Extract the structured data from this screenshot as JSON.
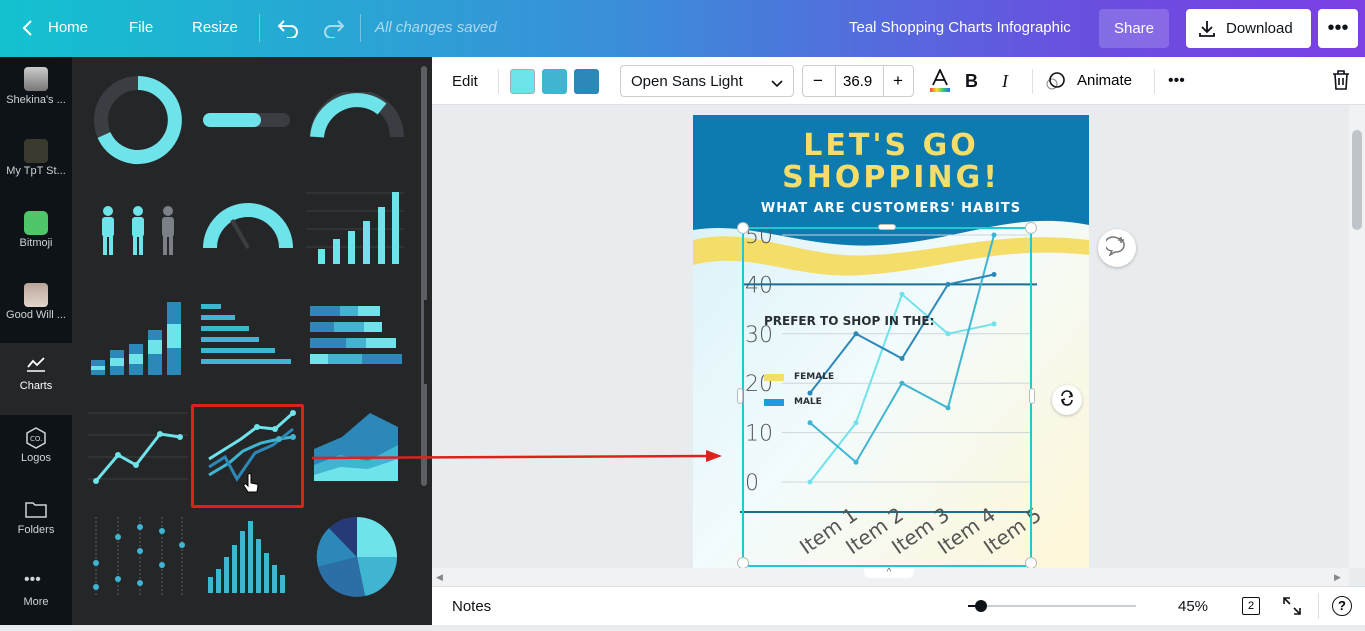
{
  "topbar": {
    "home": "Home",
    "file": "File",
    "resize": "Resize",
    "save_status": "All changes saved",
    "doc_title": "Teal Shopping Charts Infographic",
    "share": "Share",
    "download": "Download"
  },
  "rail": {
    "items": [
      {
        "label": "Shekina's ..."
      },
      {
        "label": "My TpT St..."
      },
      {
        "label": "Bitmoji"
      },
      {
        "label": "Good Will ..."
      },
      {
        "label": "Charts"
      },
      {
        "label": "Logos"
      },
      {
        "label": "Folders"
      },
      {
        "label": "More"
      }
    ]
  },
  "toolbar": {
    "edit": "Edit",
    "colors": [
      "#6fe3ea",
      "#3fb5d1",
      "#2b88b8"
    ],
    "font": "Open Sans Light",
    "font_size": "36.9",
    "animate": "Animate"
  },
  "infographic": {
    "title_line1": "LET'S GO",
    "title_line2": "SHOPPING!",
    "subtitle": "WHAT ARE CUSTOMERS' HABITS",
    "chart_caption": "PREFER TO SHOP IN THE:",
    "legend_female": "FEMALE",
    "legend_male": "MALE",
    "female_color": "#f5dd6a",
    "male_color": "#1b9ed8"
  },
  "chart_data": {
    "type": "line",
    "categories": [
      "Item 1",
      "Item 2",
      "Item 3",
      "Item 4",
      "Item 5"
    ],
    "ylim": [
      0,
      50
    ],
    "yticks": [
      "50",
      "40",
      "30",
      "20",
      "10",
      "0"
    ],
    "series": [
      {
        "values": [
          0,
          12,
          38,
          30,
          32
        ],
        "color": "#6fe3ea"
      },
      {
        "values": [
          12,
          4,
          20,
          15,
          50
        ],
        "color": "#3fb5d1"
      },
      {
        "values": [
          18,
          30,
          25,
          40,
          42
        ],
        "color": "#2b88b8"
      }
    ]
  },
  "bottombar": {
    "notes": "Notes",
    "zoom": "45%",
    "page_count": "2"
  }
}
